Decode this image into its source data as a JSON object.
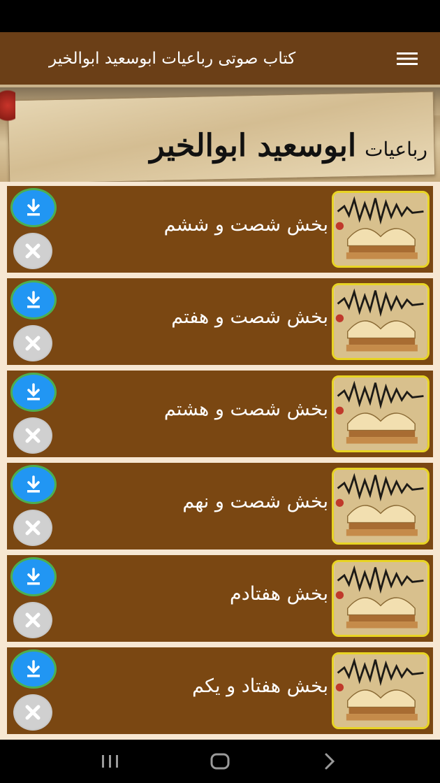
{
  "app_bar": {
    "title": "کتاب صوتی رباعیات ابوسعید ابوالخیر",
    "menu_icon": "hamburger-menu-icon",
    "background": "#6b3f17"
  },
  "banner": {
    "subtitle": "رباعیات",
    "title": "ابوسعید ابوالخیر"
  },
  "list": {
    "background": "#f7e7d2",
    "row_background": "#7a4712",
    "thumb_border": "#e8d424",
    "download_color": "#2196f3",
    "download_ring": "#4caf50",
    "items": [
      {
        "title": "بخش شصت و ششم",
        "download_icon": "download-icon",
        "remove_icon": "close-icon"
      },
      {
        "title": "بخش شصت و هفتم",
        "download_icon": "download-icon",
        "remove_icon": "close-icon"
      },
      {
        "title": "بخش شصت و هشتم",
        "download_icon": "download-icon",
        "remove_icon": "close-icon"
      },
      {
        "title": "بخش شصت و نهم",
        "download_icon": "download-icon",
        "remove_icon": "close-icon"
      },
      {
        "title": "بخش هفتادم",
        "download_icon": "download-icon",
        "remove_icon": "close-icon"
      },
      {
        "title": "بخش هفتاد و یکم",
        "download_icon": "download-icon",
        "remove_icon": "close-icon"
      }
    ]
  },
  "nav_bar": {
    "recents_icon": "recent-apps-icon",
    "home_icon": "home-icon",
    "back_icon": "back-chevron-icon"
  }
}
